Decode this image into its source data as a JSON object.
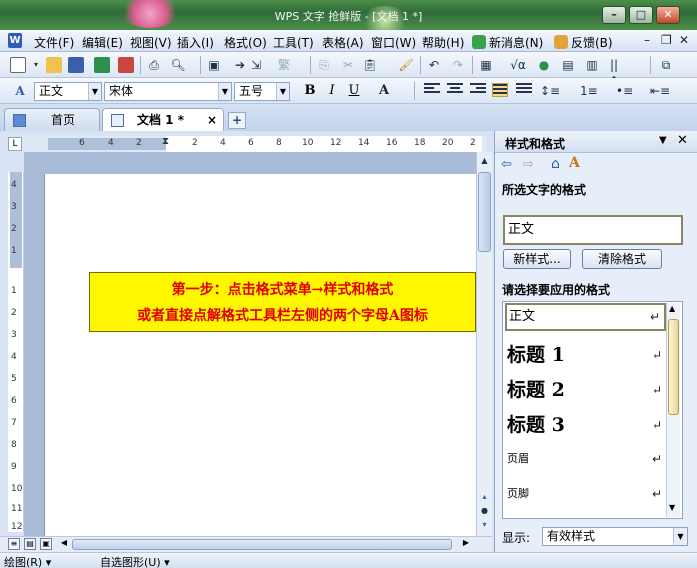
{
  "window": {
    "title": "WPS 文字 抢鲜版 - [文档 1 *]"
  },
  "menu": {
    "items": [
      "文件(F)",
      "编辑(E)",
      "视图(V)",
      "插入(I)",
      "格式(O)",
      "工具(T)",
      "表格(A)",
      "窗口(W)",
      "帮助(H)",
      "新消息(N)",
      "反馈(B)"
    ]
  },
  "format_toolbar": {
    "style": "正文",
    "font": "宋体",
    "size": "五号",
    "bold": "B",
    "italic": "I",
    "underline": "U",
    "font_color": "A"
  },
  "tabs": {
    "home": "首页",
    "doc": "文档 1 *",
    "close": "×",
    "add": "+"
  },
  "ruler": {
    "corner": "L",
    "h_ticks": [
      "6",
      "4",
      "2",
      "2",
      "4",
      "6",
      "8",
      "10",
      "12",
      "14",
      "16",
      "18",
      "20",
      "2"
    ],
    "v_ticks": [
      "4",
      "3",
      "2",
      "1",
      "1",
      "2",
      "3",
      "4",
      "5",
      "6",
      "7",
      "8",
      "9",
      "10",
      "11",
      "12"
    ]
  },
  "document": {
    "callout_line1": "第一步：点击格式菜单→样式和格式",
    "callout_line2": "或者直接点解格式工具栏左侧的两个字母A图标"
  },
  "task_pane": {
    "title": "样式和格式",
    "selected_label": "所选文字的格式",
    "current_style": "正文",
    "new_style_button": "新样式...",
    "clear_format_button": "清除格式",
    "apply_label": "请选择要应用的格式",
    "styles": [
      "正文",
      "标题 1",
      "标题 2",
      "标题 3",
      "页眉",
      "页脚"
    ],
    "return_mark": "↵",
    "show_label": "显示:",
    "show_value": "有效样式"
  },
  "drawing_toolbar": {
    "draw": "绘图(R) ▾",
    "autoshapes": "自选图形(U) ▾"
  },
  "colors": {
    "callout_bg": "#fff700",
    "callout_text": "#e10000",
    "title_bar": "#2f6b3a"
  }
}
